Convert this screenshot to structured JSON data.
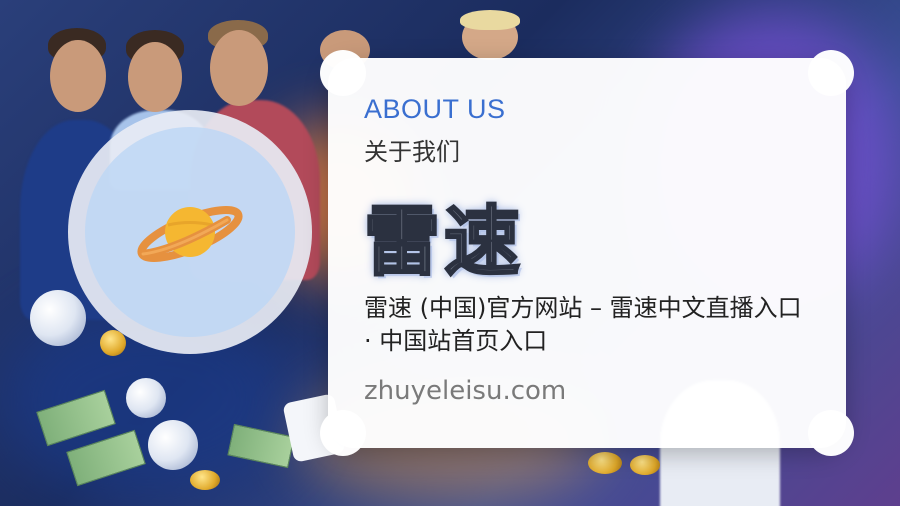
{
  "about": {
    "title_en": "ABOUT US",
    "title_cn": "关于我们"
  },
  "brand": {
    "name": "雷速"
  },
  "description": "雷速 (中国)官方网站 – 雷速中文直播入口 · 中国站首页入口",
  "domain": "zhuyeleisu.com",
  "emblem": {
    "icon": "planet-icon"
  },
  "colors": {
    "accent": "#3a6fd0",
    "card_bg": "#ffffff",
    "planet_body": "#f5b731",
    "planet_ring": "#e08a3c"
  }
}
